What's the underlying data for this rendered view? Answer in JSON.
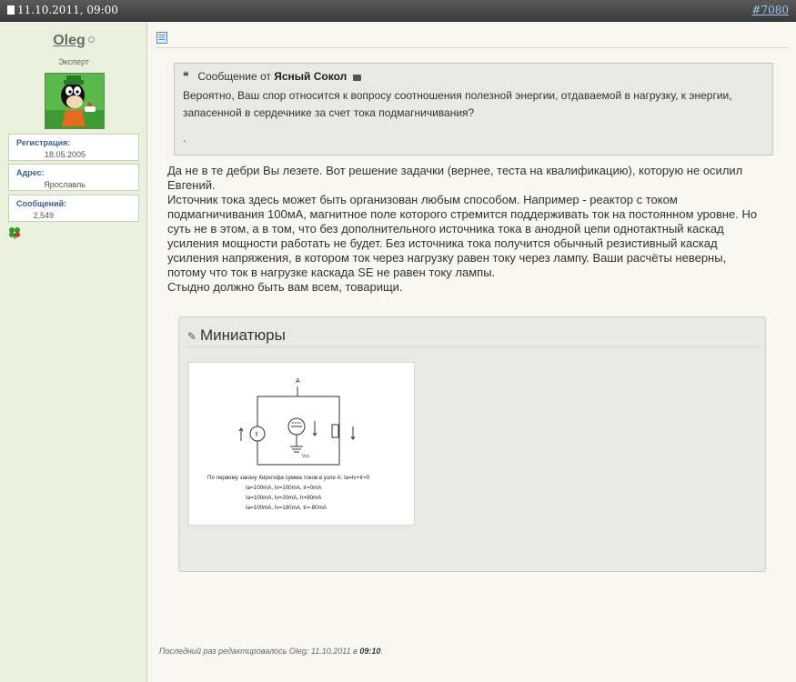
{
  "header": {
    "date": "11.10.2011, 09:00",
    "post_number": "#7080"
  },
  "user": {
    "name": "Oleg",
    "title": "Эксперт",
    "registration_label": "Регистрация:",
    "registration_value": "18.05.2005",
    "address_label": "Адрес:",
    "address_value": "Ярославль",
    "messages_label": "Сообщений:",
    "messages_value": "2,549"
  },
  "quote": {
    "prefix": "Сообщение от",
    "author": "Ясный Сокол",
    "text": "Вероятно, Ваш спор относится к вопросу соотношения полезной энергии, отдаваемой в нагрузку, к энергии, запасенной в сердечнике за счет тока подмагничивания?",
    "trailing": "."
  },
  "body": {
    "lines": [
      "Да не в те дебри Вы лезете. Вот решение задачки (вернее, теста на квалификацию), которую не осилил",
      "Евгений.",
      "Источник тока здесь может быть организован любым способом. Например - реактор с током",
      "подмагничивания 100мА, магнитное поле которого стремится поддерживать ток на постоянном уровне. Но",
      "суть не в этом, а в том, что без дополнительного источника тока в анодной цепи однотактный каскад",
      "усиления мощности работать не будет. Без источника тока получится обычный резистивный каскад",
      "усиления напряжения, в котором ток через нагрузку равен току через лампу. Ваши расчёты неверны,",
      "потому что ток в нагрузке каскада SE не равен току лампы.",
      "Стыдно должно быть вам всем, товарищи."
    ]
  },
  "attachments": {
    "title": "Миниатюры",
    "thumbnail": {
      "node_label": "A",
      "caption": "По первому закону Кирхгофа сумма токов в узле A:  Ia=Iv+Ir=0",
      "rows": [
        "Ia=100mA, Iv=100mA, Ir=0mA",
        "Ia=100mA, Iv=20mA, Ir=80mA",
        "Ia=100mA, Iv=180mA, Ir=-80mA"
      ]
    }
  },
  "edited": {
    "prefix": "Последний раз редактировалось Oleg; 11.10.2011 в",
    "time": "09:10",
    "suffix": "."
  },
  "colors": {
    "topbar": "#4a4a4a",
    "sidebar": "#e9f0db",
    "link": "#3a5f8a"
  }
}
